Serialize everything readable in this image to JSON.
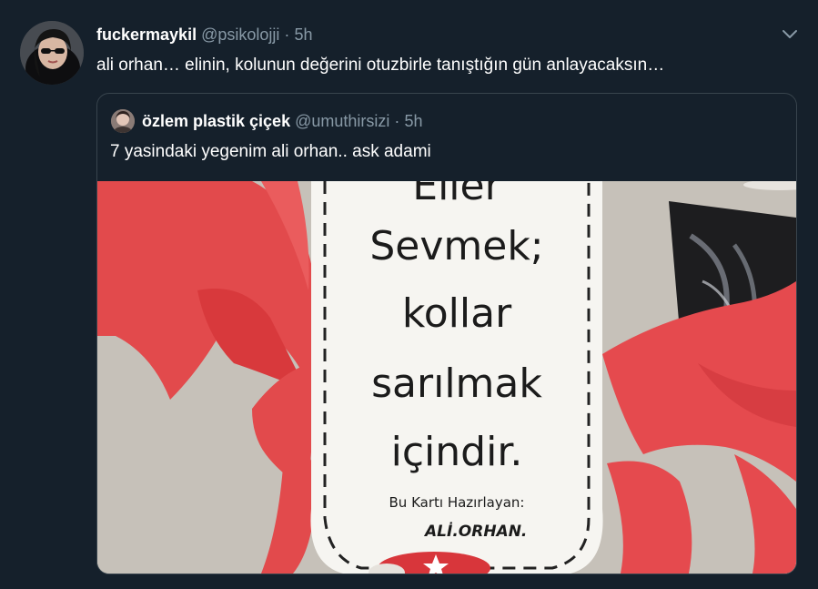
{
  "tweet": {
    "name": "fuckermaykil",
    "handle": "@psikolojji",
    "separator": "·",
    "time": "5h",
    "text": "ali orhan… elinin, kolunun değerini otuzbirle tanıştığın gün anlayacaksın…"
  },
  "quoted": {
    "name": "özlem plastik çiçek",
    "handle": "@umuthirsizi",
    "separator": "·",
    "time": "5h",
    "text": "7 yasindaki yegenim ali orhan.. ask adami"
  },
  "media": {
    "card_lines": [
      "Eller",
      "Sevmek;",
      "kollar",
      "sarılmak",
      "içindir."
    ],
    "credit_label": "Bu Kartı Hazırlayan:",
    "credit_name": "ALİ.ORHAN."
  },
  "icons": {
    "chevron": "chevron-down-icon",
    "avatar": "avatar",
    "quoted_avatar": "avatar"
  },
  "colors": {
    "background": "#15202b",
    "text": "#ffffff",
    "muted": "#8899a6",
    "border": "#38444d",
    "paper_red": "#e8464a"
  }
}
